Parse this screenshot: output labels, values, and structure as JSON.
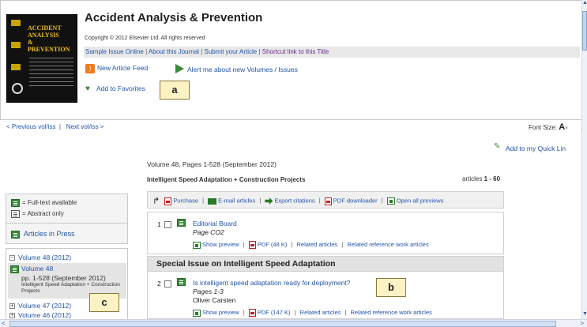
{
  "journal": {
    "title": "Accident Analysis & Prevention",
    "copyright": "Copyright © 2012 Elsevier Ltd. All rights reserved",
    "cover_title": "ACCIDENT ANALYSIS & PREVENTION"
  },
  "nav_links": [
    "Sample Issue Online",
    "About this Journal",
    "Submit your Article",
    "Shortcut link to this Title"
  ],
  "actions": {
    "new_article_feed": "New Article Feed",
    "alert_me": "Alert me about new Volumes / Issues",
    "add_to_favorites": "Add to Favorites",
    "add_to_quick_links": "Add to my Quick Lin"
  },
  "pager": {
    "prev": "< Previous vol/iss",
    "next": "Next vol/iss >"
  },
  "font_size": {
    "label": "Font Size:",
    "small": "A",
    "large": "A"
  },
  "issue": {
    "volume_heading": "Volume 48, Pages 1-528 (September 2012)",
    "title": "Intelligent Speed Adaptation + Construction Projects",
    "count_prefix": "articles",
    "count_range": "1 - 60"
  },
  "legend": {
    "full_text": "= Full-text available",
    "abstract_only": "= Abstract only",
    "articles_in_press": "Articles in Press"
  },
  "volumes": {
    "v48_year": "Volume 48 (2012)",
    "v48": "Volume 48",
    "v48_pages": "pp. 1-528 (September 2012)",
    "v48_sub": "Intelligent Speed Adaptation + Construction Projects",
    "v47_year": "Volume 47 (2012)",
    "v46_year": "Volume 46 (2012)"
  },
  "toolbar": {
    "purchase": "Purchase",
    "email": "E-mail articles",
    "export": "Export citations",
    "pdf_downloader": "PDF downloader",
    "open_previews": "Open all previews"
  },
  "articles": [
    {
      "num": "1",
      "title": "Editorial Board",
      "pages": "Page CO2",
      "author": "",
      "show_preview": "Show preview",
      "pdf": "PDF (48 K)",
      "related": "Related articles",
      "related_ref": "Related reference work articles"
    },
    {
      "num": "2",
      "title": "Is intelligent speed adaptation ready for deployment?",
      "pages": "Pages 1-3",
      "author": "Oliver Carsten",
      "show_preview": "Show preview",
      "pdf": "PDF (147 K)",
      "related": "Related articles",
      "related_ref": "Related reference work articles"
    }
  ],
  "section_header": "Special Issue on Intelligent Speed Adaptation",
  "callouts": {
    "a": "a",
    "b": "b",
    "c": "c"
  },
  "colors": {
    "link": "#2255aa",
    "green": "#3a8a3a",
    "callout_bg": "#fdf2c4"
  }
}
